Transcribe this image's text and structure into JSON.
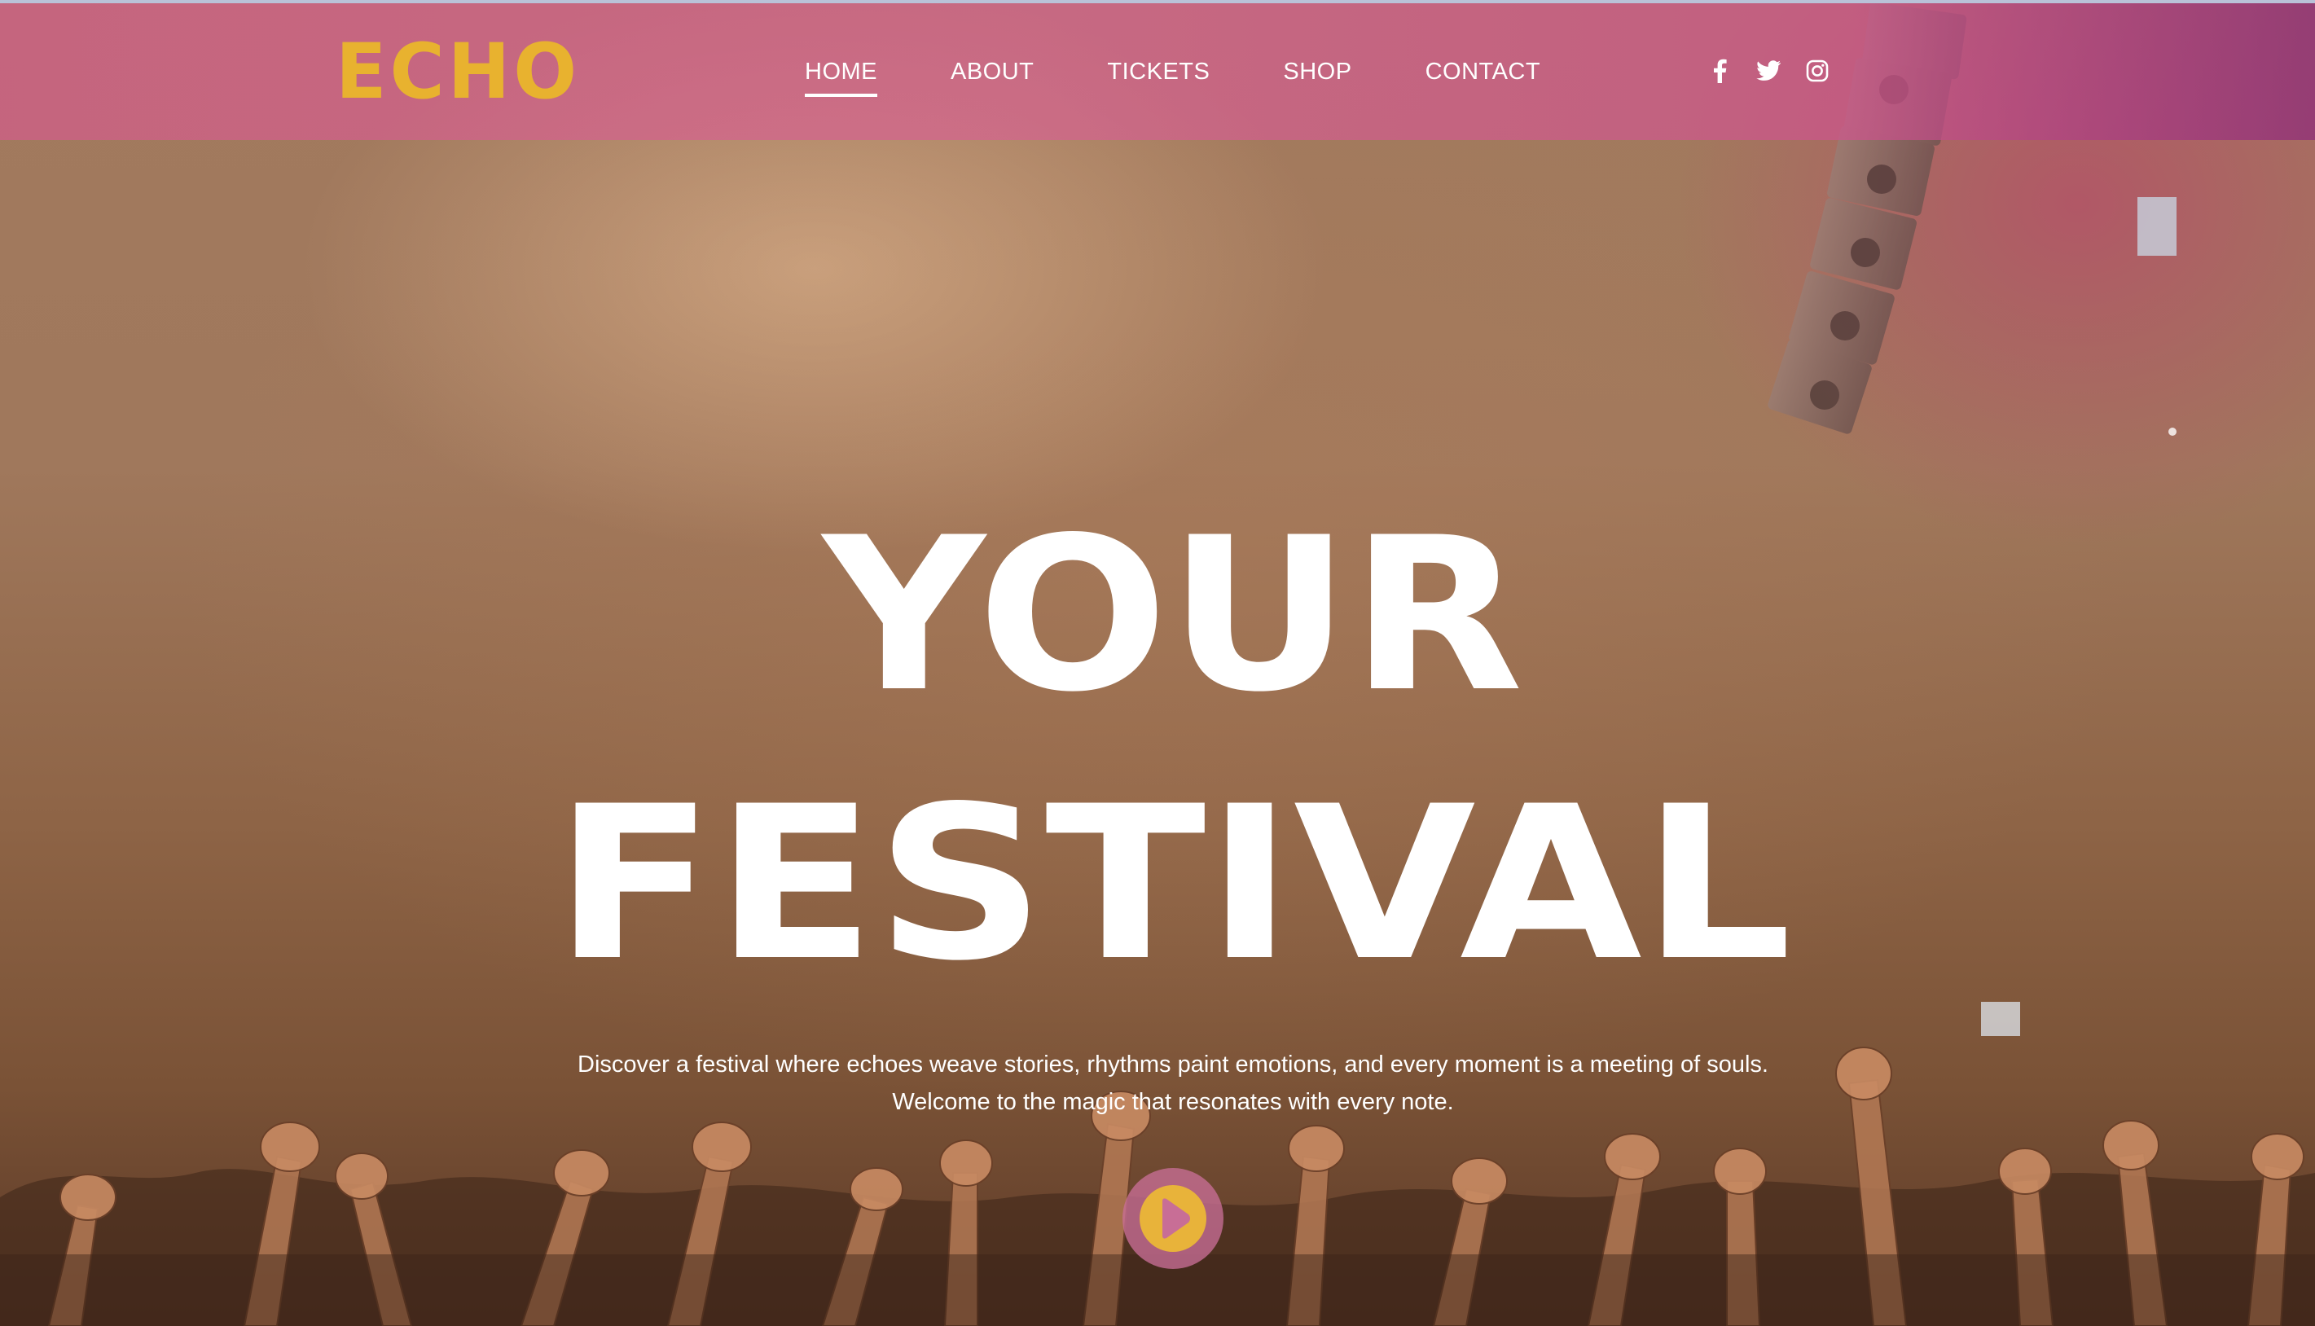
{
  "brand": {
    "logo_text": "ECHO",
    "logo_color": "#e8b22f"
  },
  "nav": {
    "items": [
      {
        "label": "HOME",
        "active": true
      },
      {
        "label": "ABOUT",
        "active": false
      },
      {
        "label": "TICKETS",
        "active": false
      },
      {
        "label": "SHOP",
        "active": false
      },
      {
        "label": "CONTACT",
        "active": false
      }
    ]
  },
  "social": {
    "icons": [
      "facebook-icon",
      "twitter-icon",
      "instagram-icon"
    ]
  },
  "hero": {
    "title_line1": "YOUR",
    "title_line2": "FESTIVAL",
    "tagline_line1": "Discover a festival where echoes weave stories, rhythms paint emotions, and every moment is a meeting of souls.",
    "tagline_line2": "Welcome to the magic that resonates with every note.",
    "play_icon": "play-icon"
  },
  "colors": {
    "header_pink": "#d45c8c",
    "accent_yellow": "#e8b33a",
    "play_ring": "#c86e96",
    "text": "#ffffff"
  }
}
